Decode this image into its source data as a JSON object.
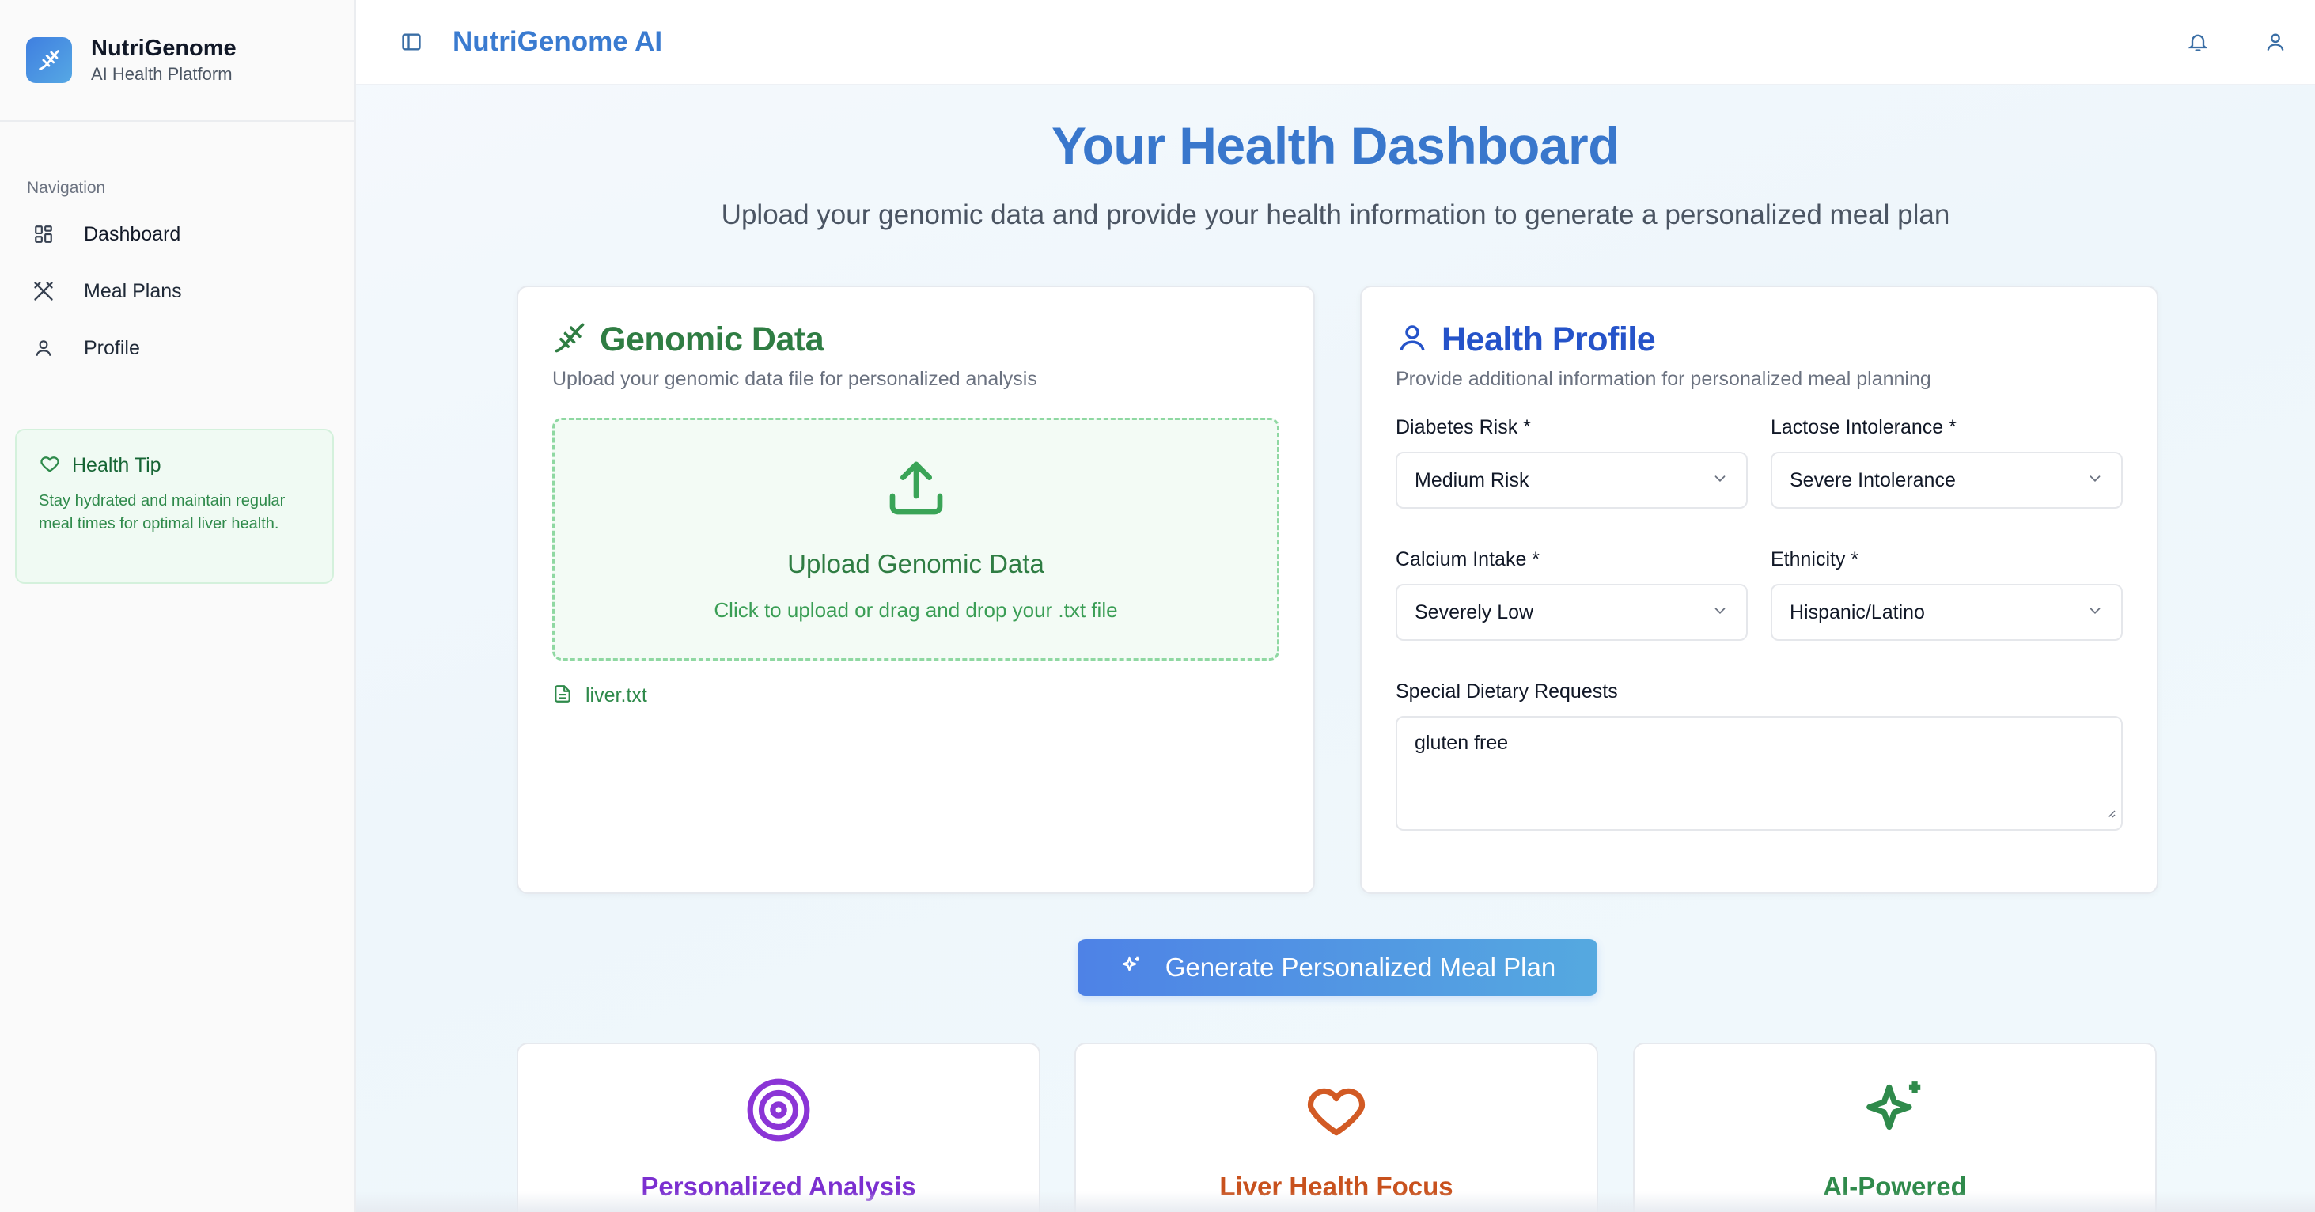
{
  "sidebar": {
    "brand_title": "NutriGenome",
    "brand_subtitle": "AI Health Platform",
    "nav_heading": "Navigation",
    "items": [
      {
        "label": "Dashboard",
        "icon": "grid-icon"
      },
      {
        "label": "Meal Plans",
        "icon": "utensils-icon"
      },
      {
        "label": "Profile",
        "icon": "user-icon"
      }
    ],
    "tip": {
      "title": "Health Tip",
      "text": "Stay hydrated and maintain regular meal times for optimal liver health."
    }
  },
  "topbar": {
    "title": "NutriGenome AI",
    "icons": [
      "sidebar-toggle-icon",
      "bell-icon",
      "user-icon"
    ]
  },
  "hero": {
    "title": "Your Health Dashboard",
    "subtitle": "Upload your genomic data and provide your health information to generate a personalized meal plan"
  },
  "genomic": {
    "title": "Genomic Data",
    "description": "Upload your genomic data file for personalized analysis",
    "dropzone_title": "Upload Genomic Data",
    "dropzone_subtitle": "Click to upload or drag and drop your .txt file",
    "file_name": "liver.txt"
  },
  "health": {
    "title": "Health Profile",
    "description": "Provide additional information for personalized meal planning",
    "fields": [
      {
        "label": "Diabetes Risk *",
        "value": "Medium Risk"
      },
      {
        "label": "Lactose Intolerance *",
        "value": "Severe Intolerance"
      },
      {
        "label": "Calcium Intake *",
        "value": "Severely Low"
      },
      {
        "label": "Ethnicity *",
        "value": "Hispanic/Latino"
      }
    ],
    "special_label": "Special Dietary Requests",
    "special_value": "gluten free"
  },
  "actions": {
    "generate_label": "Generate Personalized Meal Plan"
  },
  "features": [
    {
      "title": "Personalized Analysis",
      "icon": "target-icon",
      "color": "#7b2fd0"
    },
    {
      "title": "Liver Health Focus",
      "icon": "heart-icon",
      "color": "#c8511d"
    },
    {
      "title": "AI-Powered",
      "icon": "sparkles-icon",
      "color": "#2f8a4b"
    }
  ],
  "colors": {
    "brand_blue": "#3977cc",
    "genomic_green": "#2f7d43",
    "health_blue": "#2553c9",
    "button_start": "#4e82e6",
    "button_end": "#55a9e0"
  }
}
